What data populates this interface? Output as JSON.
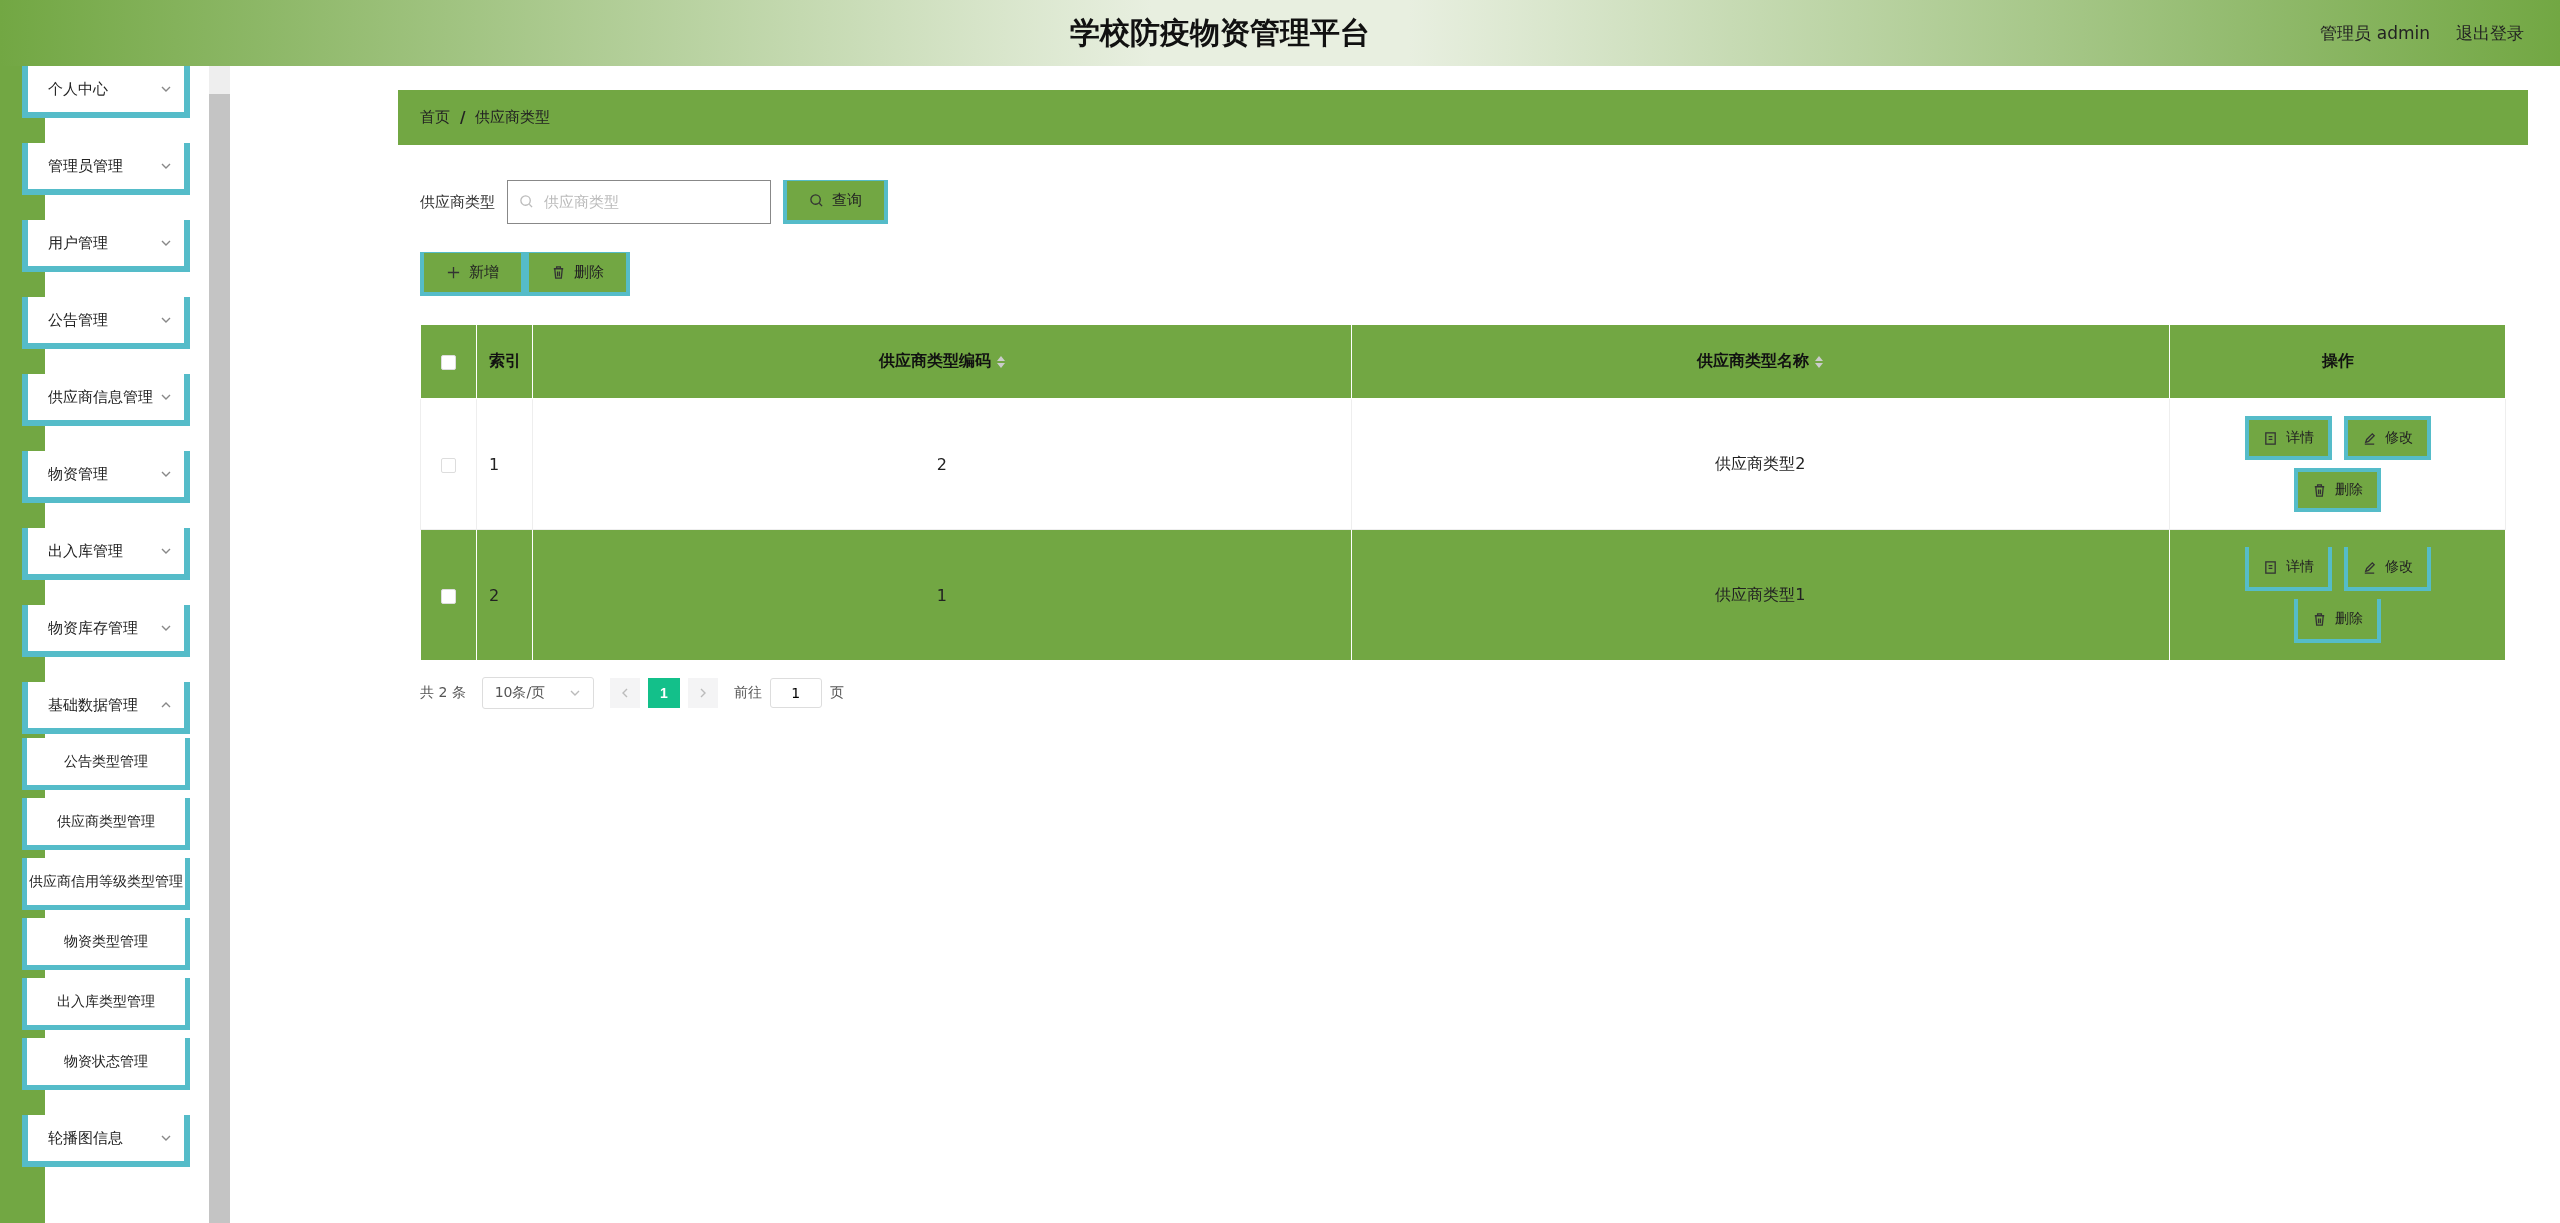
{
  "header": {
    "title": "学校防疫物资管理平台",
    "user": "管理员 admin",
    "logout": "退出登录"
  },
  "sidebar": {
    "items": [
      {
        "label": "个人中心",
        "expanded": false
      },
      {
        "label": "管理员管理",
        "expanded": false
      },
      {
        "label": "用户管理",
        "expanded": false
      },
      {
        "label": "公告管理",
        "expanded": false
      },
      {
        "label": "供应商信息管理",
        "expanded": false
      },
      {
        "label": "物资管理",
        "expanded": false
      },
      {
        "label": "出入库管理",
        "expanded": false
      },
      {
        "label": "物资库存管理",
        "expanded": false
      },
      {
        "label": "基础数据管理",
        "expanded": true,
        "children": [
          {
            "label": "公告类型管理"
          },
          {
            "label": "供应商类型管理"
          },
          {
            "label": "供应商信用等级类型管理"
          },
          {
            "label": "物资类型管理"
          },
          {
            "label": "出入库类型管理"
          },
          {
            "label": "物资状态管理"
          }
        ]
      },
      {
        "label": "轮播图信息",
        "expanded": false
      }
    ]
  },
  "breadcrumb": {
    "items": [
      "首页",
      "供应商类型"
    ],
    "separator": "/"
  },
  "search": {
    "label": "供应商类型",
    "placeholder": "供应商类型",
    "button": "查询"
  },
  "actions": [
    "新增",
    "删除"
  ],
  "table": {
    "select_all_checked": false,
    "columns": [
      {
        "label": "索引",
        "sortable": false
      },
      {
        "label": "供应商类型编码",
        "sortable": true
      },
      {
        "label": "供应商类型名称",
        "sortable": true
      },
      {
        "label": "操作",
        "sortable": false
      }
    ],
    "rows": [
      {
        "index": "1",
        "code": "2",
        "name": "供应商类型2",
        "highlighted": false,
        "checked": false,
        "buttons": [
          "详情",
          "修改",
          "删除"
        ]
      },
      {
        "index": "2",
        "code": "1",
        "name": "供应商类型1",
        "highlighted": true,
        "checked": false,
        "buttons": [
          "详情",
          "修改",
          "删除"
        ]
      }
    ]
  },
  "pagination": {
    "total": "共 2 条",
    "page_size": "10条/页",
    "pages": [
      {
        "label": "1",
        "selected": true
      }
    ],
    "goto_label": "前往",
    "goto_value": "1",
    "goto_suffix": "页"
  }
}
